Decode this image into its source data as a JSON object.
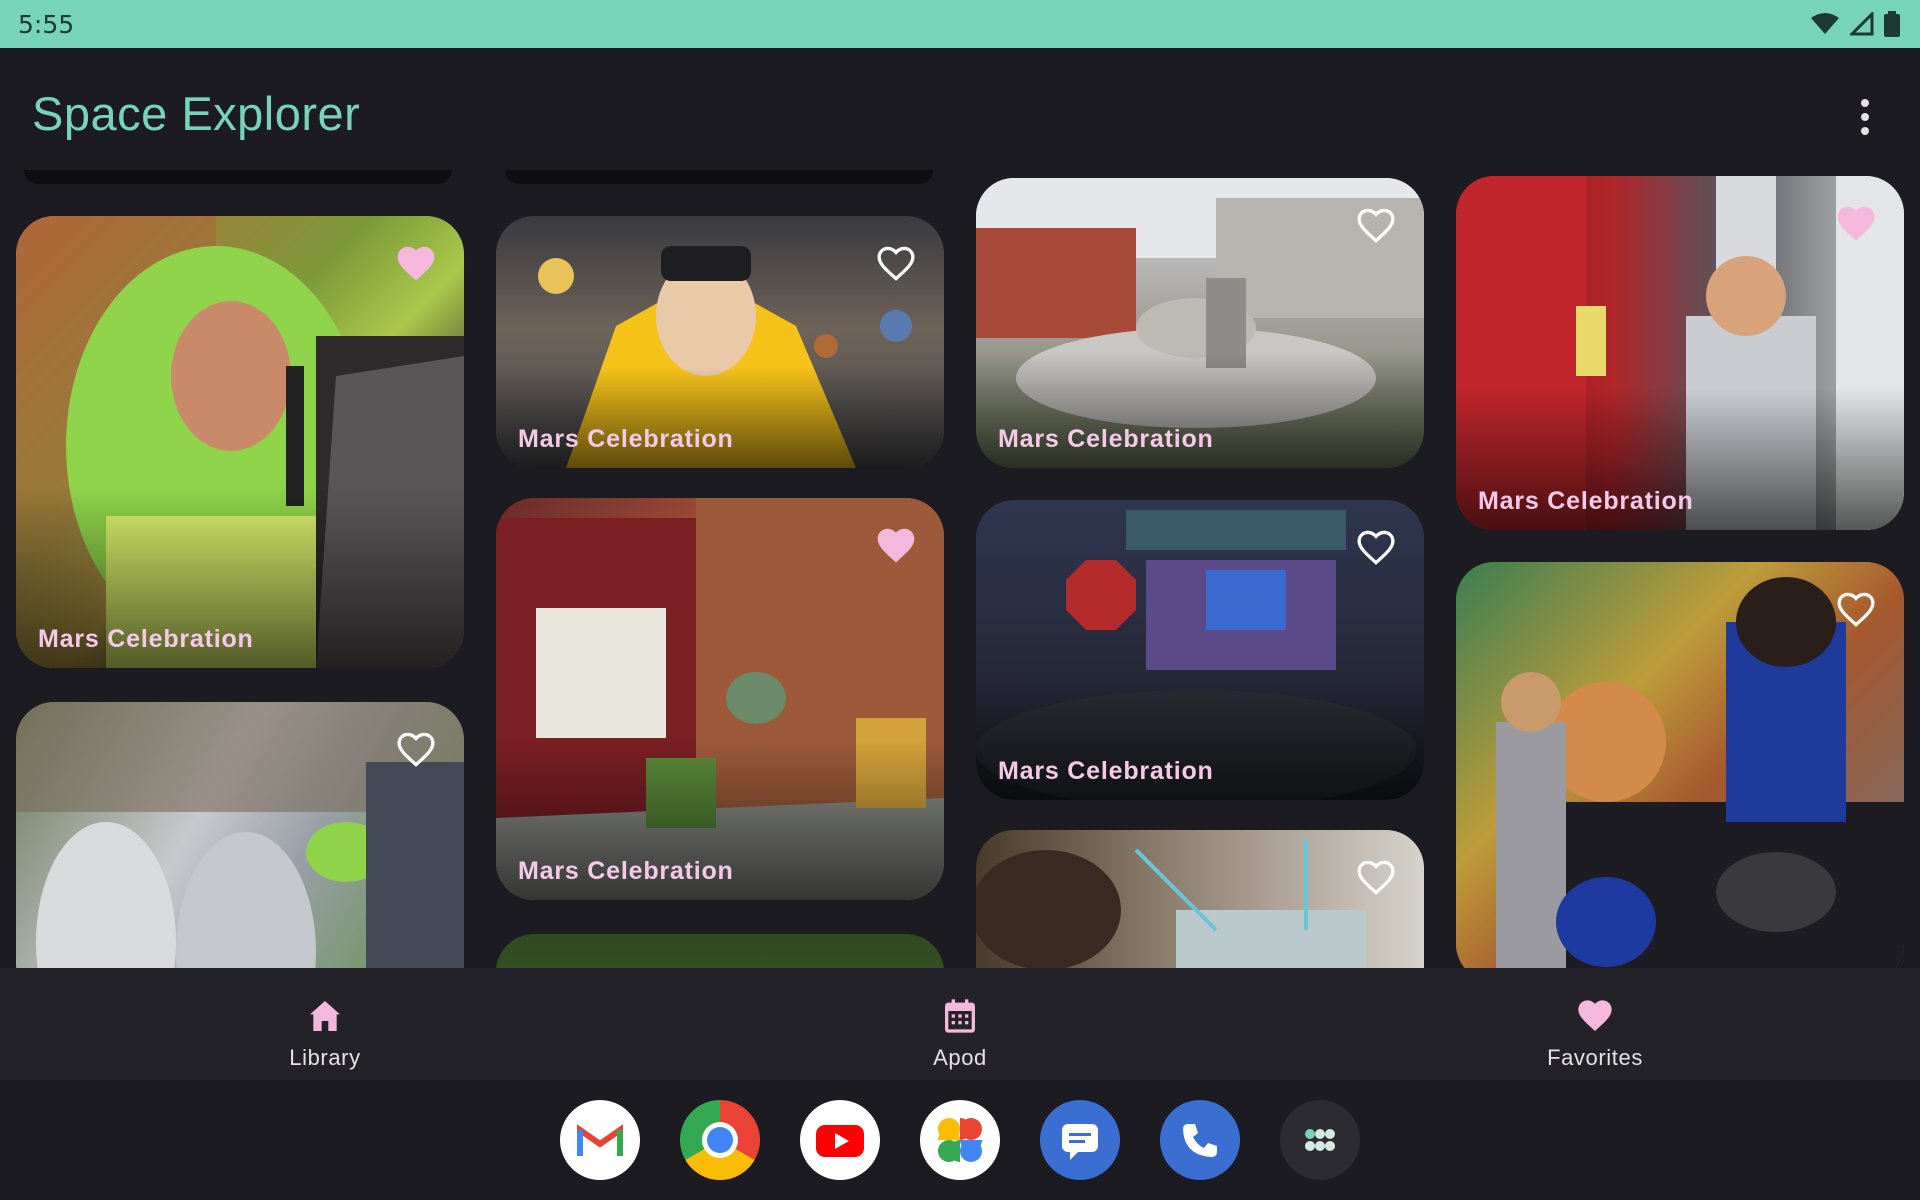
{
  "status": {
    "time": "5:55"
  },
  "header": {
    "title": "Space Explorer",
    "menu_icon": "more-vert-icon"
  },
  "cards": {
    "caption": "Mars Celebration",
    "items": [
      {
        "caption": "Mars Celebration",
        "favorite": true,
        "scene": "Green-wigged performer with microphone"
      },
      {
        "caption": "",
        "favorite": false,
        "scene": "Costumed parade performers in silver"
      },
      {
        "caption": "Mars Celebration",
        "favorite": false,
        "scene": "Child in sun costume"
      },
      {
        "caption": "Mars Celebration",
        "favorite": true,
        "scene": "Paint-Carpet-Tile store front"
      },
      {
        "caption": "Mars Celebration",
        "favorite": false,
        "scene": "People on flying saucer sculpture"
      },
      {
        "caption": "Mars Celebration",
        "favorite": false,
        "scene": "Mars Exploration Celebration stage"
      },
      {
        "caption": "",
        "favorite": false,
        "scene": "Craft activity"
      },
      {
        "caption": "Mars Celebration",
        "favorite": true,
        "scene": "Child in foil astronaut costume"
      },
      {
        "caption": "",
        "favorite": false,
        "scene": "NASA exhibit table"
      }
    ]
  },
  "nav": {
    "library": "Library",
    "apod": "Apod",
    "favorites": "Favorites"
  },
  "dock": [
    "gmail-icon",
    "chrome-icon",
    "youtube-icon",
    "photos-icon",
    "messages-icon",
    "phone-icon",
    "app-drawer-icon"
  ],
  "colors": {
    "accent": "#78d4b8",
    "pink": "#f5b8dd",
    "background": "#1c1b21"
  }
}
